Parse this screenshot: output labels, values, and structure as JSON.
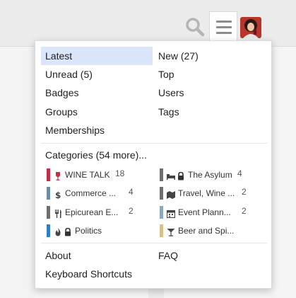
{
  "header": {
    "search_icon": "search-icon",
    "menu_icon": "hamburger-icon",
    "avatar": "user-avatar"
  },
  "menu": {
    "nav_left": [
      "Latest",
      "Unread (5)",
      "Badges",
      "Groups",
      "Memberships"
    ],
    "nav_right": [
      "New (27)",
      "Top",
      "Users",
      "Tags"
    ],
    "categories_heading": "Categories (54 more)...",
    "categories": [
      {
        "name": "WINE TALK",
        "count": "18",
        "color": "#c0304a",
        "icon": "wine-glass-icon",
        "locked": false
      },
      {
        "name": "The Asylum",
        "count": "4",
        "color": "#6f6f6f",
        "icon": "bed-icon",
        "locked": true
      },
      {
        "name": "Commerce ...",
        "count": "4",
        "color": "#6b8da3",
        "icon": "dollar-icon",
        "locked": false
      },
      {
        "name": "Travel, Wine ...",
        "count": "2",
        "color": "#6f6f6f",
        "icon": "map-icon",
        "locked": false
      },
      {
        "name": "Epicurean E...",
        "count": "2",
        "color": "#6f6f6f",
        "icon": "utensils-icon",
        "locked": false
      },
      {
        "name": "Event Plann...",
        "count": "2",
        "color": "#8aa7bd",
        "icon": "calendar-icon",
        "locked": false
      },
      {
        "name": "Politics",
        "count": "",
        "color": "#2f7fc1",
        "icon": "fire-icon",
        "locked": true
      },
      {
        "name": "Beer and Spi...",
        "count": "",
        "color": "#d8c08a",
        "icon": "cocktail-icon",
        "locked": false
      }
    ],
    "footer_left": [
      "About",
      "Keyboard Shortcuts"
    ],
    "footer_right": [
      "FAQ"
    ]
  }
}
